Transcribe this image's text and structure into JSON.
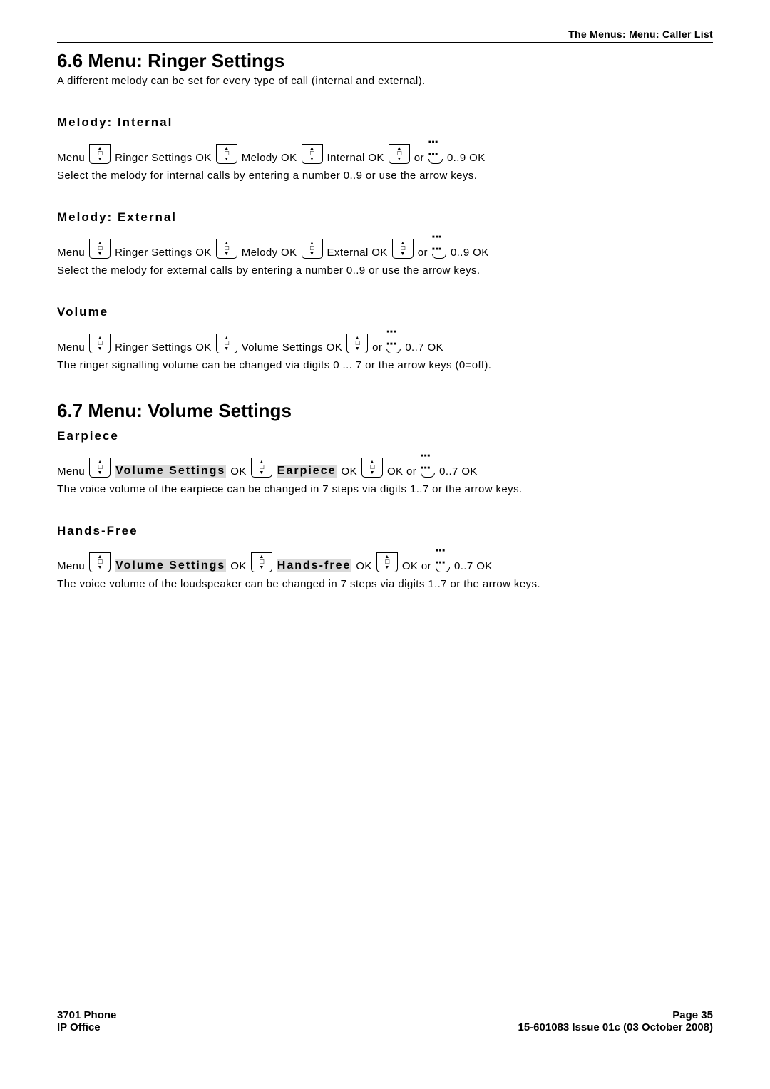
{
  "header_right": "The Menus: Menu: Caller List",
  "section_6_6": {
    "title": "6.6 Menu: Ringer Settings",
    "lead": "A different melody can be set for every type of call (internal and external)."
  },
  "melody_internal": {
    "heading": "Melody: Internal",
    "crumbs": [
      "Menu",
      "Ringer Settings OK",
      "Melody OK",
      "Internal OK",
      "or",
      "0..9 OK"
    ],
    "desc": "Select the melody for internal calls by entering a number 0..9 or use the arrow keys."
  },
  "melody_external": {
    "heading": "Melody: External",
    "crumbs": [
      "Menu",
      "Ringer Settings OK",
      "Melody OK",
      "External OK",
      "or",
      "0..9 OK"
    ],
    "desc": "Select the melody for external calls by entering a number 0..9 or use the arrow keys."
  },
  "volume": {
    "heading": "Volume",
    "crumbs": [
      "Menu",
      "Ringer Settings OK",
      "Volume Settings OK",
      "or",
      "0..7 OK"
    ],
    "desc": "The ringer signalling volume can be changed via digits 0 ... 7 or the arrow keys (0=off)."
  },
  "section_6_7": {
    "title": "6.7 Menu: Volume Settings"
  },
  "earpiece": {
    "heading": "Earpiece",
    "crumbs": [
      "Menu",
      "Volume Settings",
      "OK",
      "Earpiece",
      "OK",
      "OK or",
      "0..7 OK"
    ],
    "desc": "The voice volume of the earpiece can be changed in 7 steps via digits 1..7 or the arrow keys."
  },
  "handsfree": {
    "heading": "Hands-Free",
    "crumbs": [
      "Menu",
      "Volume Settings",
      "OK",
      "Hands-free",
      "OK",
      "OK or",
      "0..7 OK"
    ],
    "desc": "The voice volume of the loudspeaker can be changed in 7 steps via digits 1..7 or the arrow keys."
  },
  "footer": {
    "left1": "3701 Phone",
    "left2": "IP Office",
    "right1": "Page 35",
    "right2": "15-601083 Issue 01c (03 October 2008)"
  }
}
